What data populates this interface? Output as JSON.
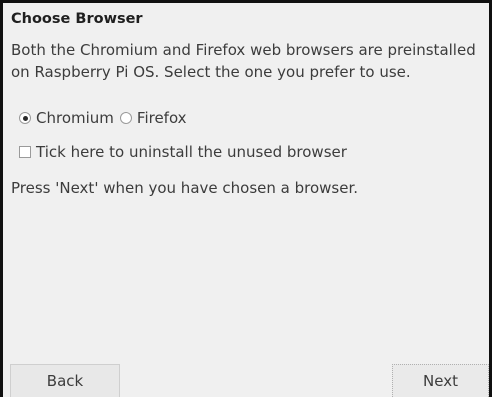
{
  "title": "Choose Browser",
  "description": "Both the Chromium and Firefox web browsers are preinstalled on Raspberry Pi OS. Select the one you prefer to use.",
  "browser_options": [
    {
      "label": "Chromium",
      "selected": true
    },
    {
      "label": "Firefox",
      "selected": false
    }
  ],
  "uninstall_checkbox": {
    "label": "Tick here to uninstall the unused browser",
    "checked": false
  },
  "hint": "Press 'Next' when you have chosen a browser.",
  "buttons": {
    "back": "Back",
    "next": "Next"
  }
}
